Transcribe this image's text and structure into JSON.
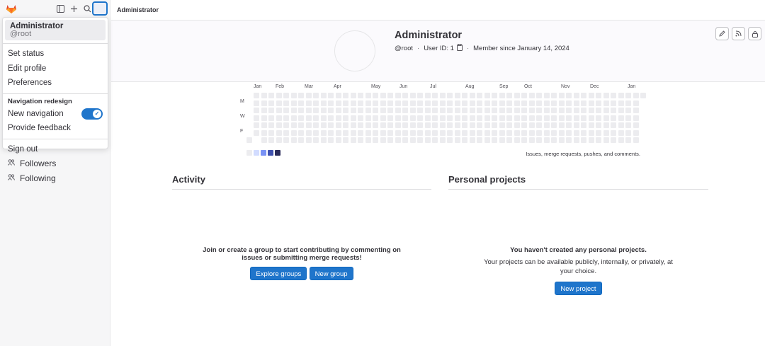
{
  "topbar": {
    "breadcrumb": "Administrator"
  },
  "dropdown": {
    "user_name": "Administrator",
    "user_handle": "@root",
    "items_top": [
      "Set status",
      "Edit profile",
      "Preferences"
    ],
    "section_heading": "Navigation redesign",
    "new_navigation_label": "New navigation",
    "new_navigation_enabled": true,
    "feedback_label": "Provide feedback",
    "sign_out_label": "Sign out"
  },
  "sidebar": {
    "links": [
      {
        "label": "Followers",
        "icon": "users-icon"
      },
      {
        "label": "Following",
        "icon": "users-icon"
      }
    ]
  },
  "profile": {
    "name": "Administrator",
    "handle": "@root",
    "user_id": "User ID: 1",
    "member_since": "Member since January 14, 2024",
    "buttons": [
      "edit-icon",
      "rss-icon",
      "lock-icon"
    ]
  },
  "calendar": {
    "months": [
      "Jan",
      "Feb",
      "Mar",
      "Apr",
      "May",
      "Jun",
      "Jul",
      "Aug",
      "Sep",
      "Oct",
      "Nov",
      "Dec",
      "Jan"
    ],
    "day_labels": [
      "M",
      "W",
      "F"
    ],
    "legend_colors": [
      "#ececef",
      "#d2dcff",
      "#7992f5",
      "#3f51ae",
      "#2a2b59"
    ],
    "caption": "Issues, merge requests, pushes, and comments."
  },
  "activity": {
    "title": "Activity",
    "empty_text": "Join or create a group to start contributing by commenting on issues or submitting merge requests!",
    "explore_label": "Explore groups",
    "new_group_label": "New group"
  },
  "projects": {
    "title": "Personal projects",
    "empty_title": "You haven't created any personal projects.",
    "empty_text": "Your projects can be available publicly, internally, or privately, at your choice.",
    "new_project_label": "New project"
  }
}
